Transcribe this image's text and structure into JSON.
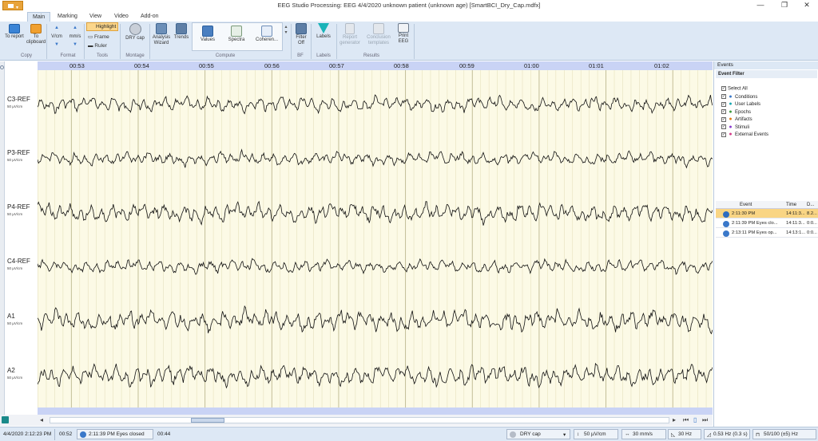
{
  "window": {
    "title": "EEG Studio Processing: EEG 4/4/2020 unknown patient (unknown age) [SmartBCI_Dry_Cap.mdfx]",
    "minimize": "—",
    "maximize": "❐",
    "close": "✕"
  },
  "tabs": [
    "Main",
    "Marking",
    "View",
    "Video",
    "Add-on"
  ],
  "ribbon": {
    "copy": {
      "to_report": "To report",
      "to_clipboard": "To clipboard",
      "group": "Copy"
    },
    "format": {
      "vcm": "V/cm",
      "mms": "mm/s",
      "group": "Format"
    },
    "tools": {
      "highlight": "Highlight",
      "frame": "Frame",
      "ruler": "Ruler",
      "group": "Tools"
    },
    "montage": {
      "dry_cap": "DRY cap",
      "group": "Montage"
    },
    "analysis": {
      "wizard": "Analysis Wizard",
      "trends": "Trends"
    },
    "compute": {
      "values": "Values",
      "spectra": "Spectra",
      "coherence": "Coheren...",
      "group": "Compute"
    },
    "bf": {
      "filter": "Filter Off",
      "group": "BF"
    },
    "labels": {
      "labels": "Labels",
      "group": "Labels"
    },
    "results": {
      "report_generator": "Report generator",
      "conclusion_templates": "Conclusion templates",
      "print_eeg": "Print EEG",
      "group": "Results"
    }
  },
  "timeline": [
    "00:53",
    "00:54",
    "00:55",
    "00:56",
    "00:57",
    "00:58",
    "00:59",
    "01:00",
    "01:01",
    "01:02"
  ],
  "channels": [
    {
      "name": "C3-REF",
      "scale": "50 µV/cm"
    },
    {
      "name": "P3-REF",
      "scale": "50 µV/cm"
    },
    {
      "name": "P4-REF",
      "scale": "50 µV/cm"
    },
    {
      "name": "C4-REF",
      "scale": "50 µV/cm"
    },
    {
      "name": "A1",
      "scale": "50 µV/cm"
    },
    {
      "name": "A2",
      "scale": "50 µV/cm"
    }
  ],
  "events_panel": {
    "title": "Events",
    "filter_title": "Event Filter",
    "filters": [
      {
        "label": "Select All",
        "icon": "",
        "color": "#333333"
      },
      {
        "label": "Conditions",
        "icon": "condition-icon",
        "color": "#3a78c9"
      },
      {
        "label": "User Labels",
        "icon": "user-label-icon",
        "color": "#19a9b3"
      },
      {
        "label": "Epochs",
        "icon": "epoch-icon",
        "color": "#3c9a3c"
      },
      {
        "label": "Artifacts",
        "icon": "artifact-icon",
        "color": "#e07b1a"
      },
      {
        "label": "Stimuli",
        "icon": "stimuli-icon",
        "color": "#8a3ccf"
      },
      {
        "label": "External Events",
        "icon": "external-event-icon",
        "color": "#d43c8a"
      }
    ],
    "columns": [
      "Event",
      "Time",
      "D..."
    ],
    "rows": [
      {
        "event": "2:11:30 PM",
        "time": "14:11:3...",
        "d": "8.2...",
        "selected": true
      },
      {
        "event": "2:11:39 PM Eyes clo...",
        "time": "14:11:3...",
        "d": "0:0...",
        "selected": false
      },
      {
        "event": "2:13:11 PM Eyes op...",
        "time": "14:13:1...",
        "d": "0:0...",
        "selected": false
      }
    ]
  },
  "statusbar": {
    "datetime": "4/4/2020 2:12:23 PM",
    "pos": "00:52",
    "event": "2:11:39 PM Eyes closed",
    "len": "00:44",
    "montage": "DRY cap",
    "sensitivity": "50 µV/cm",
    "speed": "30 mm/s",
    "lowpass": "30 Hz",
    "highpass": "0.53 Hz (0.3 s)",
    "notch": "50/100 (±5) Hz"
  }
}
